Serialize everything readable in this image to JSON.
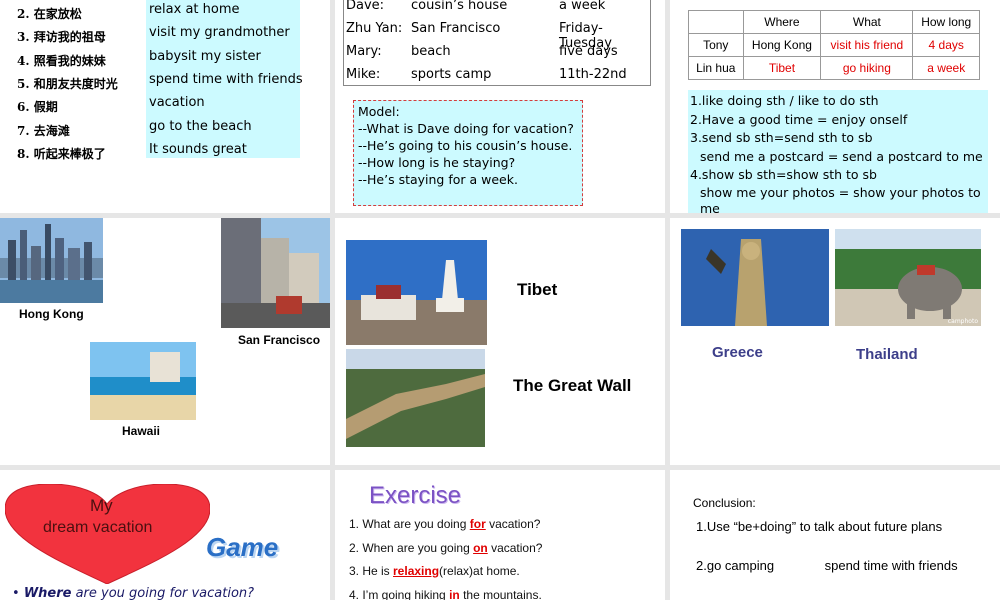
{
  "s1": {
    "rows": [
      {
        "cn": "2. 在家放松",
        "en": "relax at home"
      },
      {
        "cn": "3. 拜访我的祖母",
        "en": "visit my grandmother"
      },
      {
        "cn": "4. 照看我的妹妹",
        "en": "babysit my sister"
      },
      {
        "cn": "5. 和朋友共度时光",
        "en": "spend time with friends"
      },
      {
        "cn": "6. 假期",
        "en": "vacation"
      },
      {
        "cn": "7. 去海滩",
        "en": "go to the beach"
      },
      {
        "cn": "8. 听起来棒极了",
        "en": "It sounds great"
      }
    ]
  },
  "s2": {
    "table": [
      {
        "name": "Dave:",
        "what": "cousin’s house",
        "when": "a week"
      },
      {
        "name": "Zhu Yan:",
        "what": "San Francisco",
        "when": "Friday-Tuesday"
      },
      {
        "name": "Mary:",
        "what": "beach",
        "when": "five days"
      },
      {
        "name": "Mike:",
        "what": "sports camp",
        "when": "11th-22nd"
      }
    ],
    "model": [
      "Model:",
      "--What is Dave doing for vacation?",
      "--He’s going to his cousin’s house.",
      "--How long is he staying?",
      "--He’s staying for a week."
    ]
  },
  "s3": {
    "headers": [
      "",
      "Where",
      "What",
      "How long"
    ],
    "rows": [
      [
        "Tony",
        "Hong Kong",
        "visit his friend",
        "4 days"
      ],
      [
        "Lin hua",
        "Tibet",
        "go hiking",
        "a week"
      ]
    ],
    "notes": [
      "1.like doing sth / like to do sth",
      "2.Have a good time = enjoy onself",
      "3.send sb sth=send sth to sb",
      "send me a postcard  = send a postcard to me",
      "4.show sb sth=show sth to sb",
      "show me your photos = show your photos to me"
    ]
  },
  "s4": {
    "hong_kong": "Hong Kong",
    "san_francisco": "San Francisco",
    "hawaii": "Hawaii"
  },
  "s5": {
    "tibet": "Tibet",
    "great_wall": "The Great Wall"
  },
  "s6": {
    "greece": "Greece",
    "thailand": "Thailand",
    "watermark": "camphoto"
  },
  "s7": {
    "heart_line1": "My",
    "heart_line2": "dream vacation",
    "game": "Game",
    "question": "Where are you going for vacation?",
    "question_em": "Where"
  },
  "s8": {
    "title": "Exercise",
    "items": [
      {
        "pre": "1. What are you doing ",
        "ans": "for",
        "post": " vacation?"
      },
      {
        "pre": "2. When are you going ",
        "ans": "on",
        "post": " vacation?"
      },
      {
        "pre": "3. He is ",
        "ans": "relaxing",
        "post": "(relax)at home."
      },
      {
        "pre": "4. I’m going hiking ",
        "ans": "in",
        "post": " the mountains."
      }
    ]
  },
  "s9": {
    "title": "Conclusion:",
    "items": [
      "1.Use  “be+doing”  to talk about future plans",
      "2.go camping              spend time with friends"
    ]
  }
}
